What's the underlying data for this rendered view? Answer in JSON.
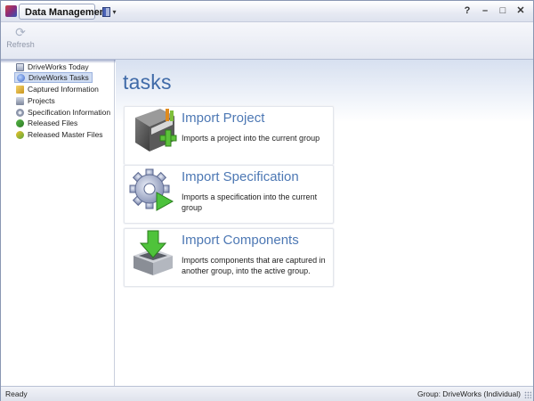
{
  "window": {
    "title": "Data Management",
    "controls": [
      "?",
      "–",
      "□",
      "✕"
    ]
  },
  "ribbon": {
    "refresh_label": "Refresh"
  },
  "sidebar": {
    "items": [
      {
        "label": "DriveWorks Today",
        "icon": "calendar-icon",
        "selected": false
      },
      {
        "label": "DriveWorks Tasks",
        "icon": "tasks-globe-icon",
        "selected": true
      },
      {
        "label": "Captured Information",
        "icon": "pencil-icon",
        "selected": false
      },
      {
        "label": "Projects",
        "icon": "project-book-icon",
        "selected": false
      },
      {
        "label": "Specification Information",
        "icon": "gear-icon",
        "selected": false
      },
      {
        "label": "Released Files",
        "icon": "release-icon",
        "selected": false
      },
      {
        "label": "Released Master Files",
        "icon": "master-release-icon",
        "selected": false
      }
    ]
  },
  "main": {
    "title": "tasks",
    "tasks": [
      {
        "title": "Import Project",
        "description": "Imports a project into the current group",
        "icon": "book-plus-icon"
      },
      {
        "title": "Import Specification",
        "description": "Imports a specification into the current group",
        "icon": "gear-play-icon"
      },
      {
        "title": "Import Components",
        "description": "Imports components that are captured in another group, into the active group.",
        "icon": "download-tray-icon"
      }
    ]
  },
  "statusbar": {
    "left": "Ready",
    "right": "Group: DriveWorks (Individual)"
  },
  "colors": {
    "accent_blue": "#3f6aa8",
    "task_title": "#4d78b4",
    "selection": "#cfdcf2"
  }
}
